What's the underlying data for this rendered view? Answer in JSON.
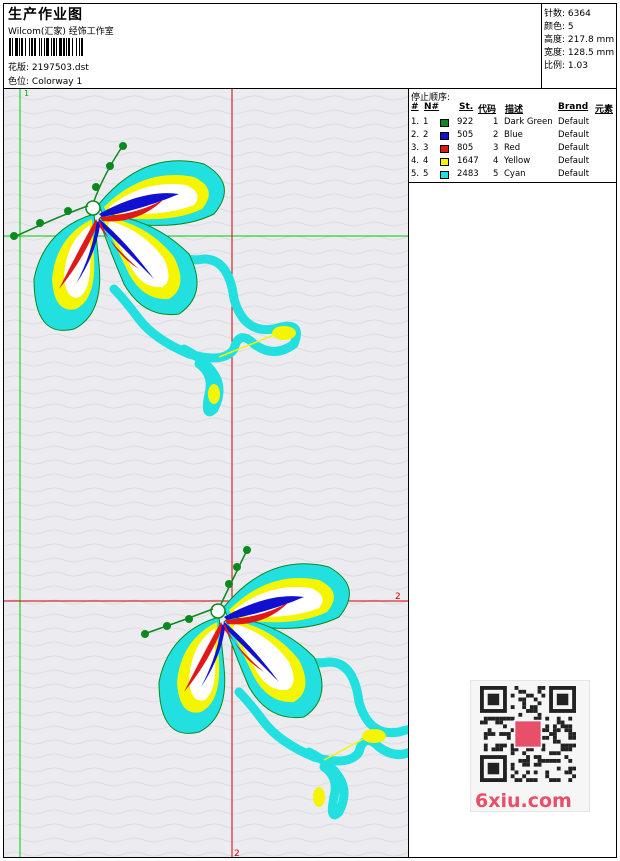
{
  "header": {
    "title": "生产作业图",
    "studio": "Wilcom(汇家) 经饰工作室",
    "design_label": "花版:",
    "design_value": "2197503.dst",
    "colorway_label": "色位:",
    "colorway_value": "Colorway 1"
  },
  "stats": [
    {
      "label": "针数:",
      "value": "6364"
    },
    {
      "label": "颜色:",
      "value": "5"
    },
    {
      "label": "高度:",
      "value": "217.8 mm"
    },
    {
      "label": "宽度:",
      "value": "128.5 mm"
    },
    {
      "label": "比例:",
      "value": "1.03"
    }
  ],
  "legend": {
    "title": "停止顺序:",
    "headers": [
      "#",
      "N#",
      "St.",
      "代码",
      "描述",
      "Brand",
      "元素"
    ],
    "rows": [
      {
        "num": "1.",
        "n": "1",
        "color": "#0a8a1e",
        "stitches": "922",
        "code": "1",
        "desc": "Dark Green",
        "brand": "Default"
      },
      {
        "num": "2.",
        "n": "2",
        "color": "#1010d0",
        "stitches": "505",
        "code": "2",
        "desc": "Blue",
        "brand": "Default"
      },
      {
        "num": "3.",
        "n": "3",
        "color": "#e01818",
        "stitches": "805",
        "code": "3",
        "desc": "Red",
        "brand": "Default"
      },
      {
        "num": "4.",
        "n": "4",
        "color": "#f5f500",
        "stitches": "1647",
        "code": "4",
        "desc": "Yellow",
        "brand": "Default"
      },
      {
        "num": "5.",
        "n": "5",
        "color": "#22e0e0",
        "stitches": "2483",
        "code": "5",
        "desc": "Cyan",
        "brand": "Default"
      }
    ]
  },
  "canvas": {
    "marker_1": "1",
    "marker_2_right": "2",
    "marker_2_bottom": "2",
    "guide_green": "#00cc00",
    "guide_red": "#cc0000"
  },
  "watermark": {
    "text": "6xiu.com",
    "color": "#e8506a"
  }
}
